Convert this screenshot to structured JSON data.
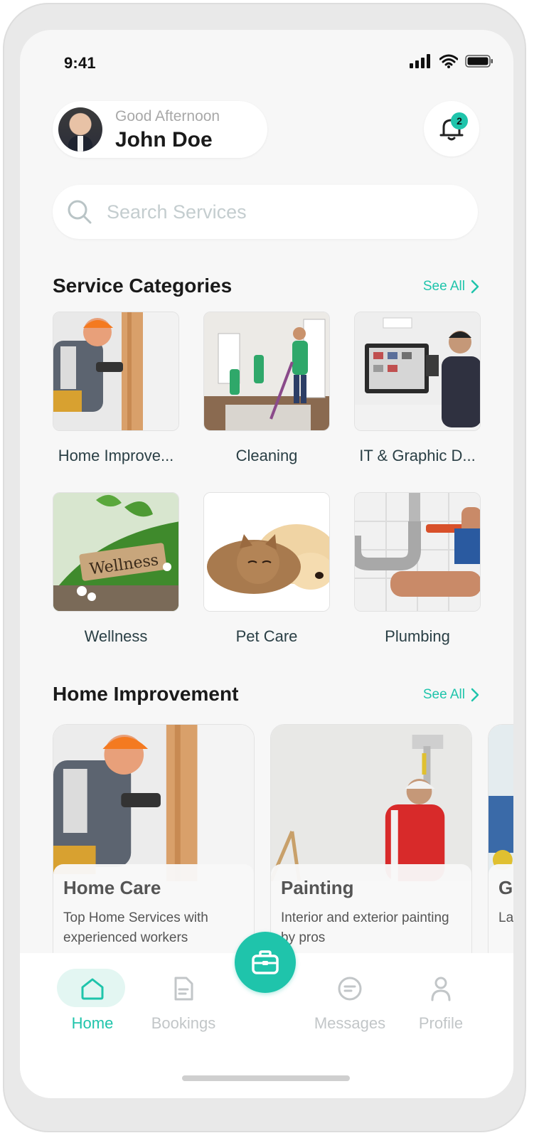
{
  "status_bar": {
    "time": "9:41"
  },
  "header": {
    "greeting": "Good Afternoon",
    "user_name": "John Doe",
    "notification_count": "2"
  },
  "search": {
    "placeholder": "Search Services"
  },
  "categories_section": {
    "title": "Service Categories",
    "see_all": "See All",
    "items": [
      {
        "label": "Home Improve...",
        "image": "home-improvement-photo"
      },
      {
        "label": "Cleaning",
        "image": "cleaning-photo"
      },
      {
        "label": "IT & Graphic D...",
        "image": "it-graphic-design-photo"
      },
      {
        "label": "Wellness",
        "image": "wellness-photo",
        "image_text": "Wellness"
      },
      {
        "label": "Pet Care",
        "image": "pet-care-photo"
      },
      {
        "label": "Plumbing",
        "image": "plumbing-photo"
      }
    ]
  },
  "home_improvement_section": {
    "title": "Home Improvement",
    "see_all": "See All",
    "cards": [
      {
        "title": "Home Care",
        "description": "Top Home Services with experienced workers"
      },
      {
        "title": "Painting",
        "description": "Interior and exterior painting by pros"
      },
      {
        "title": "G",
        "description": "La m"
      }
    ]
  },
  "bottom_nav": {
    "items": [
      {
        "label": "Home",
        "icon": "home-icon",
        "active": true
      },
      {
        "label": "Bookings",
        "icon": "document-icon",
        "active": false
      },
      {
        "label": "Messages",
        "icon": "message-icon",
        "active": false
      },
      {
        "label": "Profile",
        "icon": "user-icon",
        "active": false
      }
    ],
    "center_icon": "briefcase-icon"
  },
  "colors": {
    "accent": "#1fc4ab",
    "background": "#f7f7f7",
    "inactive": "#c2c6c8"
  }
}
